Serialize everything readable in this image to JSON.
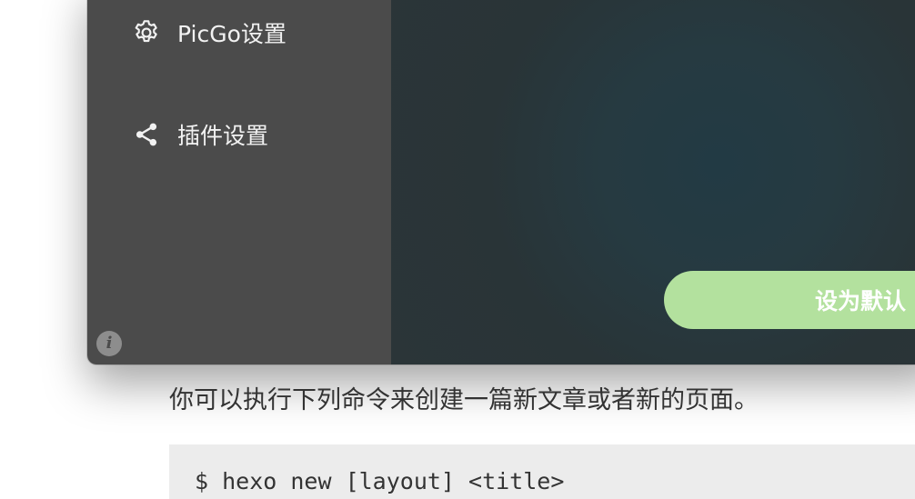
{
  "sidebar": {
    "items": [
      {
        "label": "PicGo设置",
        "icon": "gear-icon"
      },
      {
        "label": "插件设置",
        "icon": "share-icon"
      }
    ],
    "info_icon": "info-icon"
  },
  "main": {
    "default_button_label": "设为默认"
  },
  "document": {
    "paragraph": "你可以执行下列命令来创建一篇新文章或者新的页面。",
    "code_line": "$ hexo new [layout] <title>"
  },
  "colors": {
    "sidebar_bg": "#4b4b4b",
    "content_bg": "#263a41",
    "button_green": "#b3e19e"
  }
}
